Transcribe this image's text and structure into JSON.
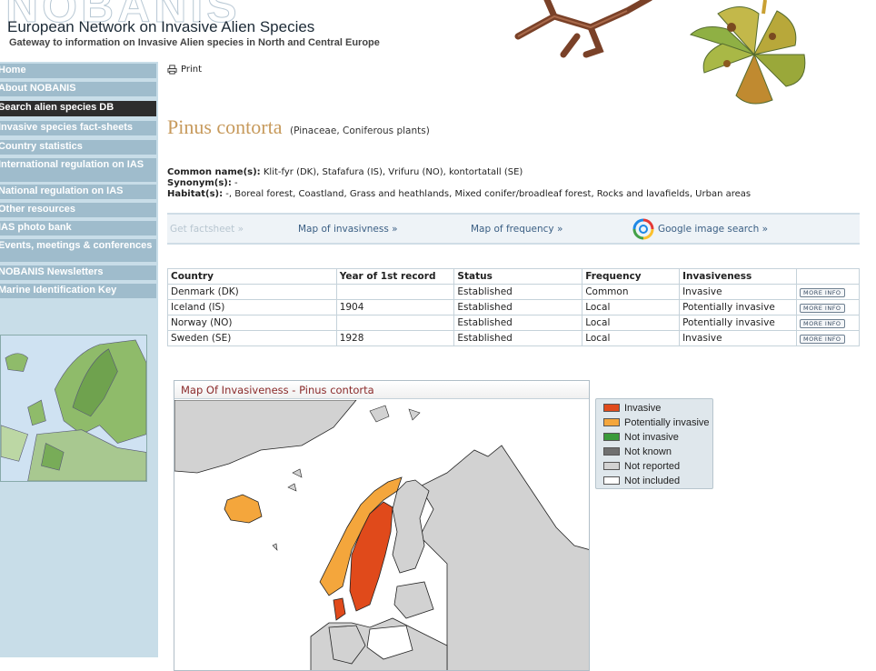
{
  "header": {
    "logo": "NOBANIS",
    "title": "European Network on Invasive Alien Species",
    "subtitle": "Gateway to information on Invasive Alien species in North and Central Europe"
  },
  "nav": [
    {
      "label": "Home",
      "active": false
    },
    {
      "label": "About NOBANIS",
      "active": false
    },
    {
      "label": "Search alien species DB",
      "active": true
    },
    {
      "label": "Invasive species fact-sheets",
      "active": false
    },
    {
      "label": "Country statistics",
      "active": false
    },
    {
      "label": "International regulation on IAS",
      "active": false
    },
    {
      "label": "National regulation on IAS",
      "active": false
    },
    {
      "label": "Other resources",
      "active": false
    },
    {
      "label": "IAS photo bank",
      "active": false
    },
    {
      "label": "Events, meetings & conferences",
      "active": false
    },
    {
      "label": "NOBANIS Newsletters",
      "active": false
    },
    {
      "label": "Marine Identification Key",
      "active": false
    }
  ],
  "print_label": "Print",
  "species": {
    "name": "Pinus contorta",
    "family": "(Pinaceae, Coniferous plants)"
  },
  "info": {
    "common_label": "Common name(s):",
    "common_value": " Klit-fyr (DK), Stafafura (IS), Vrifuru (NO), kontortatall (SE)",
    "synonym_label": "Synonym(s):",
    "synonym_value": " -",
    "habitat_label": "Habitat(s):",
    "habitat_value": " -, Boreal forest, Coastland, Grass and heathlands, Mixed conifer/broadleaf forest, Rocks and lavafields, Urban areas"
  },
  "actions": {
    "factsheet": "Get factsheet »",
    "map_invasiveness": "Map of invasivness »",
    "map_frequency": "Map of frequency »",
    "google": "Google image search »"
  },
  "table": {
    "headers": [
      "Country",
      "Year of 1st record",
      "Status",
      "Frequency",
      "Invasiveness",
      ""
    ],
    "rows": [
      [
        "Denmark (DK)",
        "",
        "Established",
        "Common",
        "Invasive"
      ],
      [
        "Iceland (IS)",
        "1904",
        "Established",
        "Local",
        "Potentially invasive"
      ],
      [
        "Norway (NO)",
        "",
        "Established",
        "Local",
        "Potentially invasive"
      ],
      [
        "Sweden (SE)",
        "1928",
        "Established",
        "Local",
        "Invasive"
      ]
    ],
    "more_label": "MORE INFO"
  },
  "map": {
    "title": "Map Of Invasiveness - Pinus contorta"
  },
  "legend": [
    {
      "label": "Invasive",
      "color": "#e04a1b"
    },
    {
      "label": "Potentially invasive",
      "color": "#f4a63c"
    },
    {
      "label": "Not invasive",
      "color": "#3a9a3a"
    },
    {
      "label": "Not known",
      "color": "#707070"
    },
    {
      "label": "Not reported",
      "color": "#d2d2d2"
    },
    {
      "label": "Not included",
      "color": "#ffffff"
    }
  ]
}
